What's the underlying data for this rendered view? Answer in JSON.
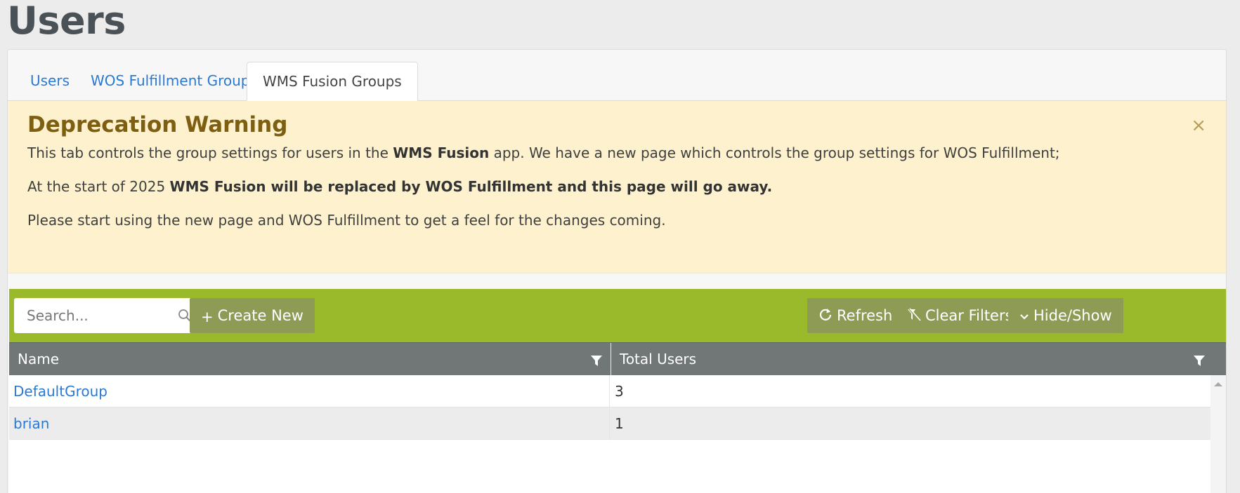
{
  "page": {
    "title": "Users"
  },
  "tabs": [
    {
      "label": "Users",
      "active": false
    },
    {
      "label": "WOS Fulfillment Groups",
      "active": false
    },
    {
      "label": "WMS Fusion Groups",
      "active": true
    }
  ],
  "alert": {
    "title": "Deprecation Warning",
    "close_glyph": "×",
    "line1_pre": "This tab controls the group settings for users in the ",
    "line1_bold": "WMS Fusion",
    "line1_post": " app. We have a new page which controls the group settings for WOS Fulfillment;",
    "line2_pre": "At the start of 2025 ",
    "line2_bold": "WMS Fusion will be replaced by WOS Fulfillment and this page will go away.",
    "line3": "Please start using the new page and WOS Fulfillment to get a feel for the changes coming."
  },
  "toolbar": {
    "search_placeholder": "Search...",
    "create_new": "Create New",
    "create_new_icon": "+",
    "refresh": "Refresh",
    "clear_filters": "Clear Filters",
    "hide_show": "Hide/Show"
  },
  "grid": {
    "columns": [
      "Name",
      "Total Users"
    ],
    "rows": [
      {
        "name": "DefaultGroup",
        "total": "3"
      },
      {
        "name": "brian",
        "total": "1"
      }
    ]
  },
  "colors": {
    "toolbar_bg": "#9aba2b",
    "button_bg": "#8e9b55",
    "header_bg": "#707776",
    "alert_bg": "#fdf2cd",
    "link": "#2a7ad4"
  }
}
